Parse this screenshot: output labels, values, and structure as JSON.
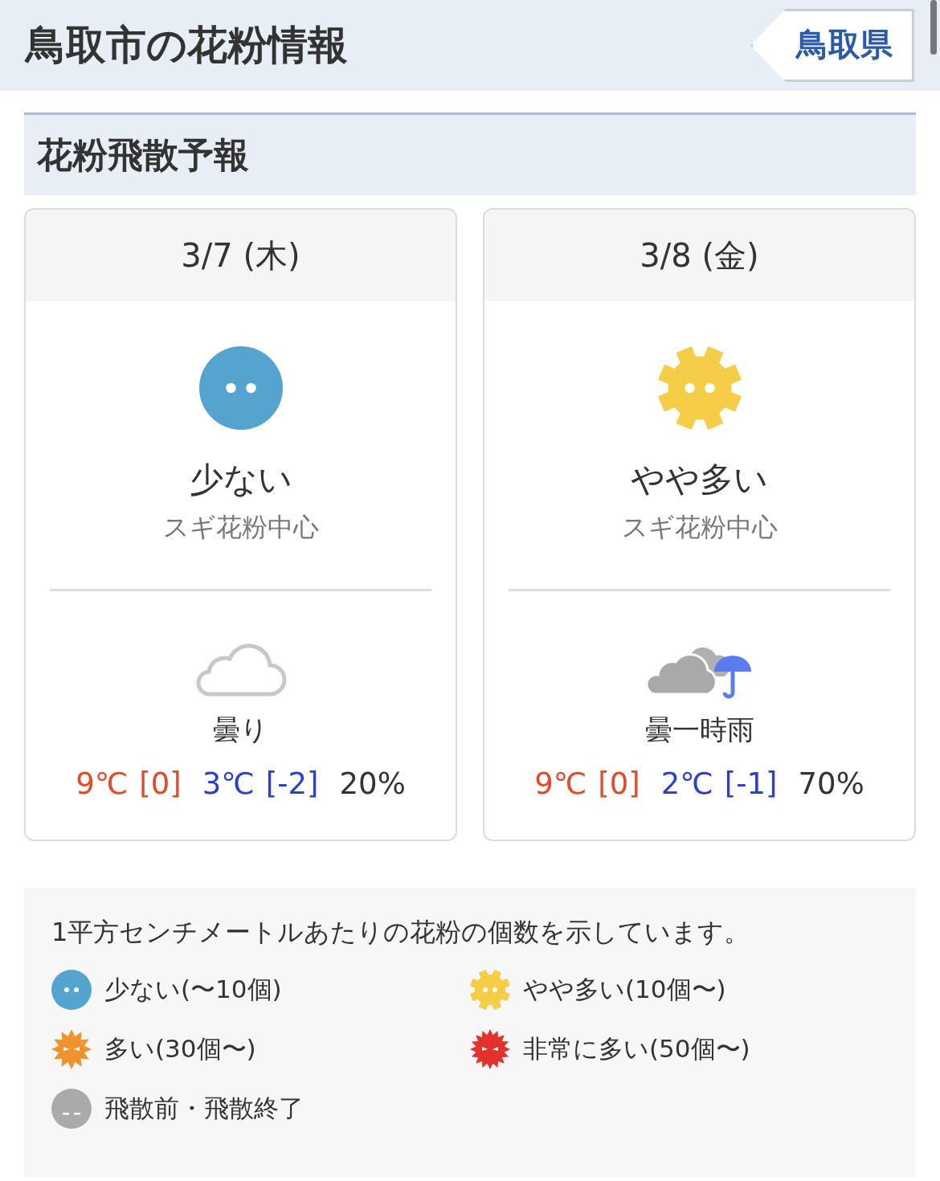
{
  "header": {
    "title": "鳥取市の花粉情報",
    "back_link": "鳥取県"
  },
  "section": {
    "title": "花粉飛散予報"
  },
  "days": [
    {
      "date": "3/7 (木)",
      "pollen": {
        "kind": "few",
        "label": "少ない",
        "sub": "スギ花粉中心"
      },
      "weather": {
        "kind": "cloudy",
        "label": "曇り"
      },
      "high": "9℃",
      "high_diff": "[0]",
      "low": "3℃",
      "low_diff": "[-2]",
      "rain": "20%"
    },
    {
      "date": "3/8 (金)",
      "pollen": {
        "kind": "somewhat_many",
        "label": "やや多い",
        "sub": "スギ花粉中心"
      },
      "weather": {
        "kind": "cloudy_rain",
        "label": "曇一時雨"
      },
      "high": "9℃",
      "high_diff": "[0]",
      "low": "2℃",
      "low_diff": "[-1]",
      "rain": "70%"
    }
  ],
  "legend": {
    "note": "1平方センチメートルあたりの花粉の個数を示しています。",
    "items": [
      {
        "kind": "few",
        "label": "少ない(〜10個)"
      },
      {
        "kind": "somewhat_many",
        "label": "やや多い(10個〜)"
      },
      {
        "kind": "many",
        "label": "多い(30個〜)"
      },
      {
        "kind": "very_many",
        "label": "非常に多い(50個〜)"
      },
      {
        "kind": "none",
        "label": "飛散前・飛散終了"
      }
    ]
  }
}
